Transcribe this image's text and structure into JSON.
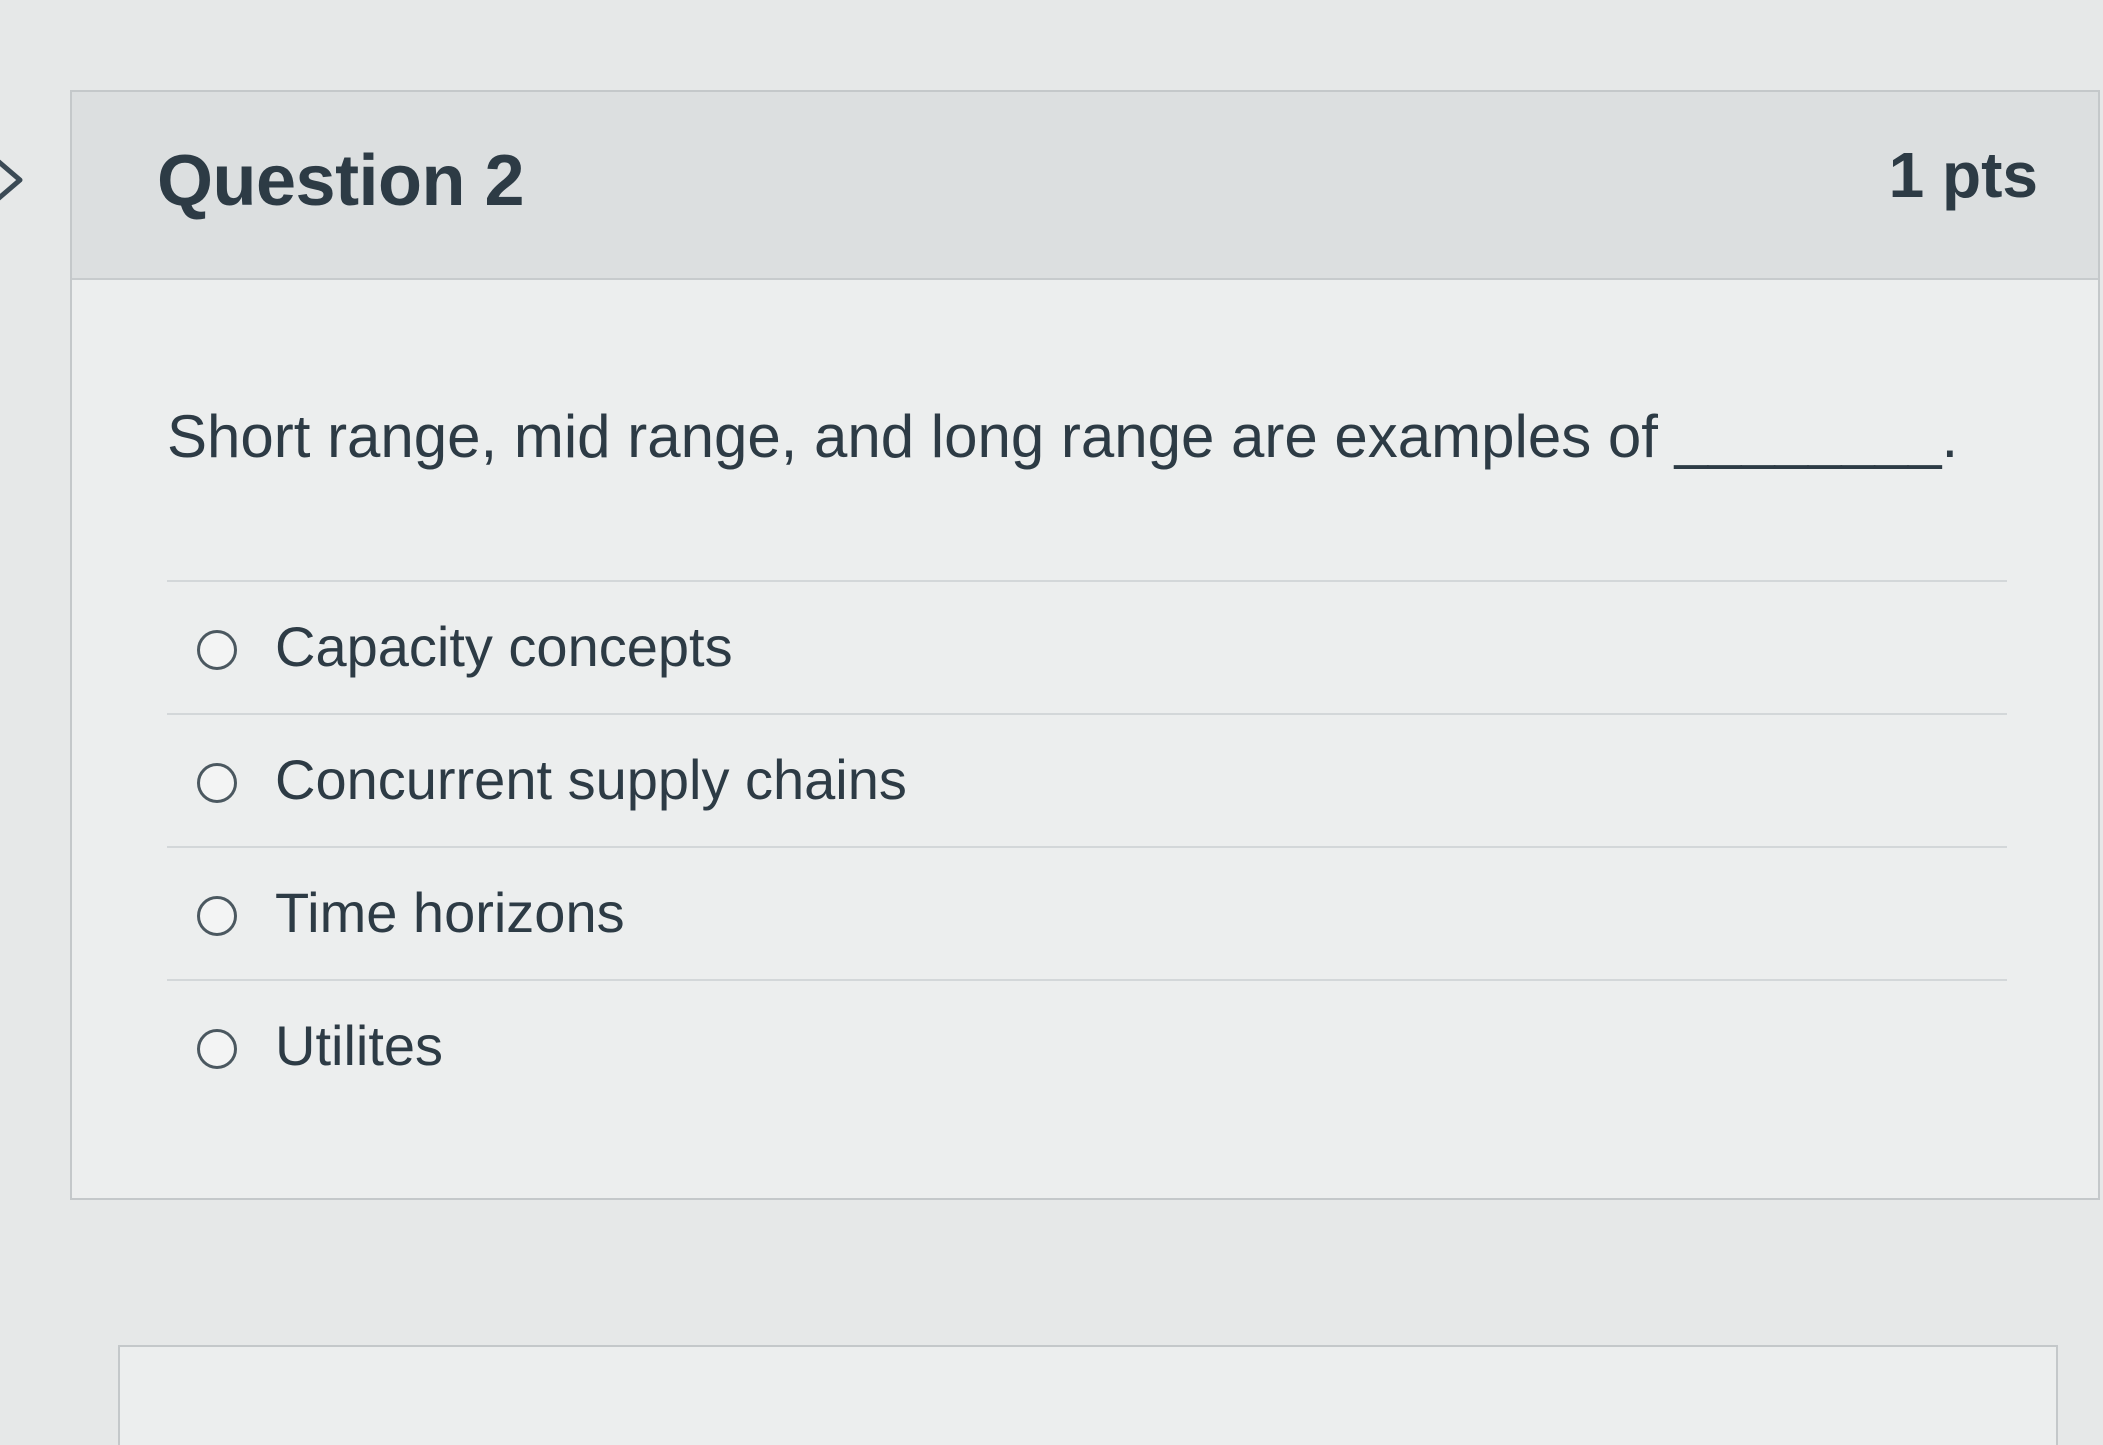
{
  "question": {
    "title": "Question 2",
    "points": "1 pts",
    "text": "Short range, mid range, and long range are examples of ________.",
    "answers": [
      {
        "label": "Capacity concepts"
      },
      {
        "label": "Concurrent supply chains"
      },
      {
        "label": "Time horizons"
      },
      {
        "label": "Utilites"
      }
    ]
  },
  "icons": {
    "nav": "chevron-right-icon",
    "option": "radio-button-icon"
  },
  "colors": {
    "text": "#2d3b45",
    "header_bg": "#dcdfe0",
    "card_bg": "#eceeee",
    "border": "#c4c8ca"
  }
}
